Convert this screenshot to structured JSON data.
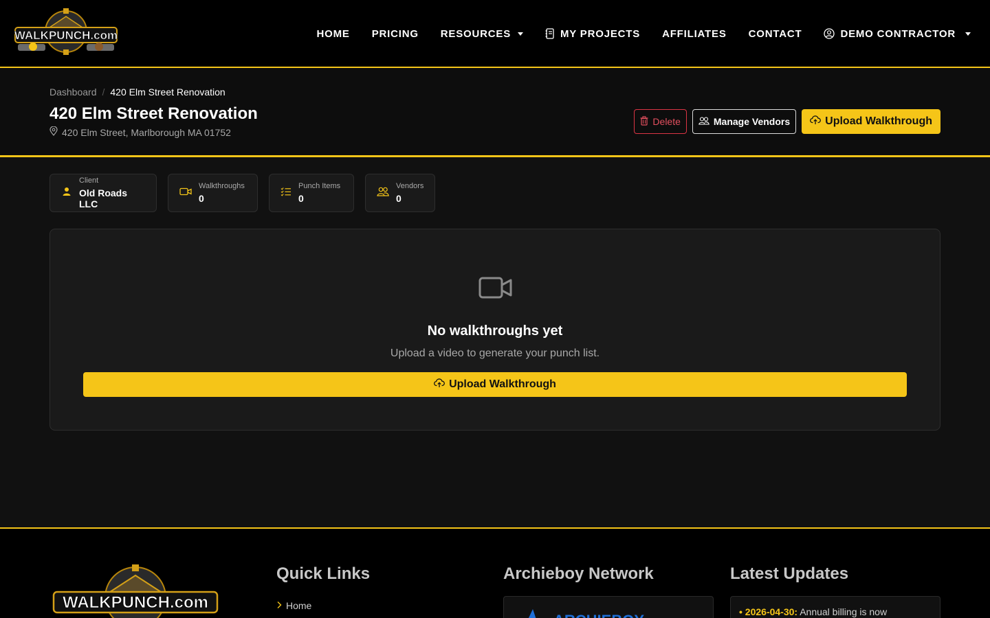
{
  "brand": {
    "accent": "#f5c518",
    "danger": "#dc3545",
    "logo_text": "WALKPUNCH.com"
  },
  "nav": {
    "items": [
      {
        "label": "HOME"
      },
      {
        "label": "PRICING"
      },
      {
        "label": "RESOURCES"
      },
      {
        "label": "MY PROJECTS",
        "icon": "journal-icon"
      },
      {
        "label": "AFFILIATES"
      },
      {
        "label": "CONTACT"
      },
      {
        "label": "DEMO CONTRACTOR",
        "icon": "user-circle-icon"
      }
    ]
  },
  "breadcrumb": {
    "parent": "Dashboard",
    "separator": "/",
    "current": "420 Elm Street Renovation"
  },
  "project": {
    "title": "420 Elm Street Renovation",
    "address": "420 Elm Street, Marlborough MA 01752"
  },
  "actions": {
    "delete_label": "Delete",
    "vendors_label": "Manage Vendors",
    "upload_label": "Upload Walkthrough"
  },
  "stats": [
    {
      "label": "Client",
      "value": "Old Roads LLC",
      "icon": "person-icon"
    },
    {
      "label": "Walkthroughs",
      "value": "0",
      "icon": "camera-video-icon"
    },
    {
      "label": "Punch Items",
      "value": "0",
      "icon": "list-check-icon"
    },
    {
      "label": "Vendors",
      "value": "0",
      "icon": "people-icon"
    }
  ],
  "empty_state": {
    "title": "No walkthroughs yet",
    "subtitle": "Upload a video to generate your punch list.",
    "button_label": "Upload Walkthrough"
  },
  "footer": {
    "quick_links_title": "Quick Links",
    "quick_links": [
      "Home"
    ],
    "network_title": "Archieboy Network",
    "network_logo_text": "ARCHIEBOY",
    "updates_title": "Latest Updates",
    "updates": [
      {
        "date": "2026-04-30:",
        "text": "Annual billing is now"
      }
    ]
  }
}
